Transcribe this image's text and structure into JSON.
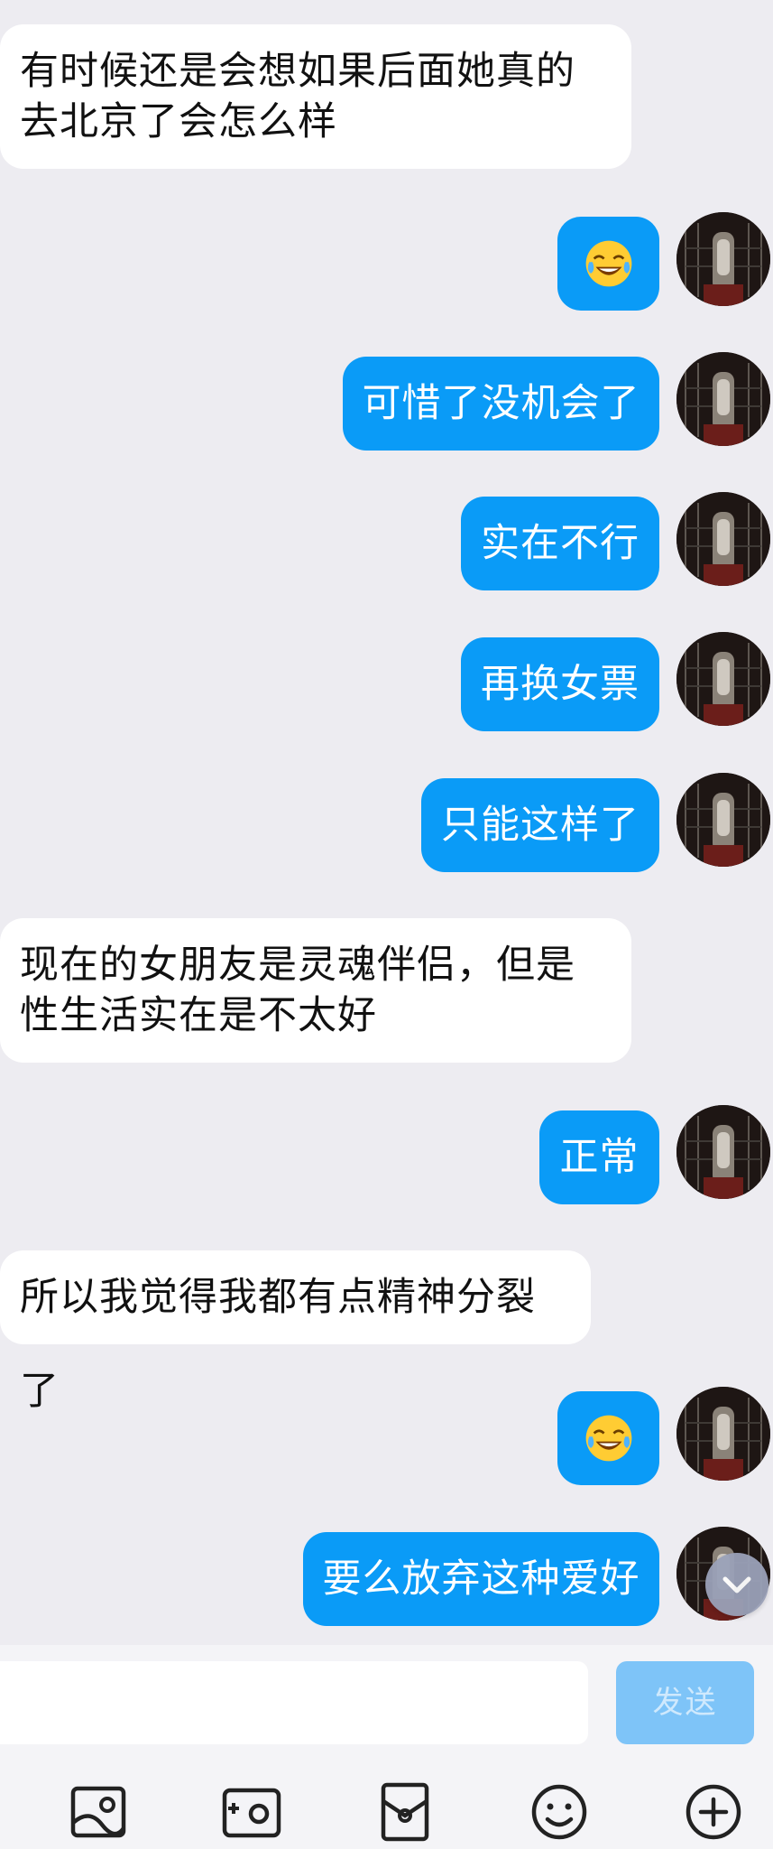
{
  "messages": [
    {
      "dir": "in",
      "text": "有时候还是会想如果后面她真的去北京了会怎么样"
    },
    {
      "dir": "out",
      "emoji": "tears-of-joy"
    },
    {
      "dir": "out",
      "text": "可惜了没机会了"
    },
    {
      "dir": "out",
      "text": "实在不行"
    },
    {
      "dir": "out",
      "text": "再换女票"
    },
    {
      "dir": "out",
      "text": "只能这样了"
    },
    {
      "dir": "in",
      "text": "现在的女朋友是灵魂伴侣，但是性生活实在是不太好"
    },
    {
      "dir": "out",
      "text": "正常"
    },
    {
      "dir": "in",
      "text": "所以我觉得我都有点精神分裂了"
    },
    {
      "dir": "out",
      "emoji": "tears-of-joy"
    },
    {
      "dir": "out",
      "text": "要么放弃这种爱好"
    }
  ],
  "composer": {
    "input_value": "",
    "send_label": "发送"
  },
  "toolbar": {
    "icons": [
      "image-icon",
      "camera-icon",
      "red-packet-icon",
      "emoji-icon",
      "plus-icon"
    ]
  },
  "colors": {
    "background": "#edecf1",
    "outgoing_bubble": "#0a9bf7",
    "incoming_bubble": "#ffffff",
    "send_button_disabled": "#7ec4f8"
  }
}
